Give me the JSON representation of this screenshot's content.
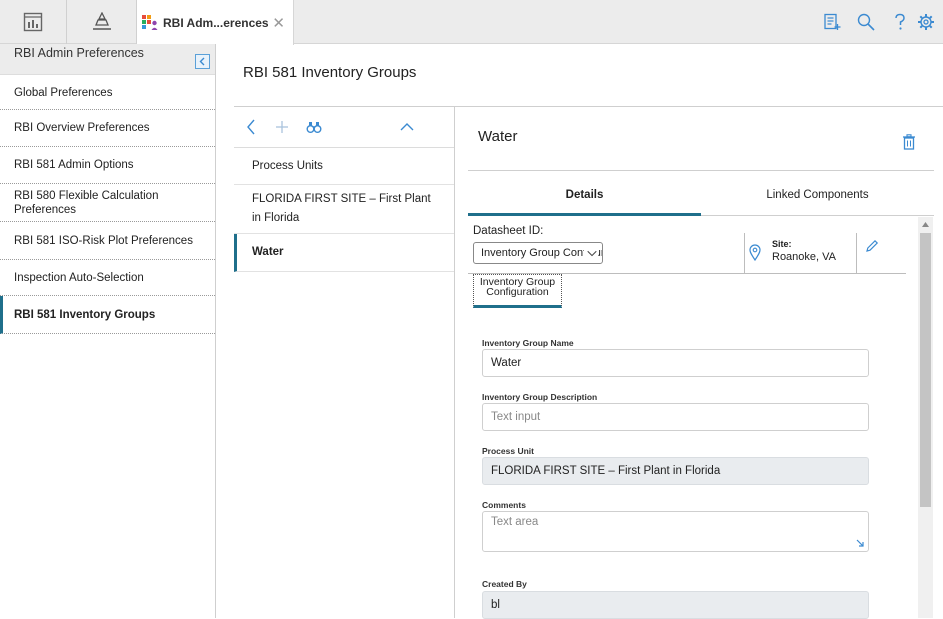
{
  "tab": {
    "label": "RBI Adm...erences",
    "close": "✕"
  },
  "sidebar": {
    "header": "RBI Admin Preferences",
    "items": [
      {
        "label": "Global Preferences"
      },
      {
        "label": "RBI Overview Preferences"
      },
      {
        "label": "RBI 581 Admin Options"
      },
      {
        "label": "RBI 580 Flexible Calculation Preferences"
      },
      {
        "label": "RBI 581 ISO-Risk Plot Preferences"
      },
      {
        "label": "Inspection Auto-Selection"
      },
      {
        "label": "RBI 581 Inventory Groups"
      }
    ]
  },
  "main": {
    "title": "RBI 581 Inventory Groups"
  },
  "list": {
    "items": [
      {
        "label": "Process Units"
      },
      {
        "label": "FLORIDA FIRST SITE – First Plant in Florida"
      },
      {
        "label": "Water"
      }
    ]
  },
  "detail": {
    "title": "Water",
    "tabs": [
      {
        "label": "Details"
      },
      {
        "label": "Linked Components"
      }
    ],
    "datasheet_label": "Datasheet ID:",
    "datasheet_value": "Inventory Group Configuration",
    "site_label": "Site:",
    "site_value": "Roanoke, VA",
    "section_tab": "Inventory Group Configuration",
    "fields": {
      "name_label": "Inventory Group Name",
      "name_value": "Water",
      "desc_label": "Inventory Group Description",
      "desc_placeholder": "Text input",
      "unit_label": "Process Unit",
      "unit_value": "FLORIDA FIRST SITE – First Plant in Florida",
      "comments_label": "Comments",
      "comments_placeholder": "Text area",
      "created_label": "Created By",
      "created_value": "bl"
    }
  },
  "colors": {
    "accent": "#1f6f8b",
    "icon_blue": "#3b8ad1",
    "sidebar_header_bg": "#ececec"
  }
}
